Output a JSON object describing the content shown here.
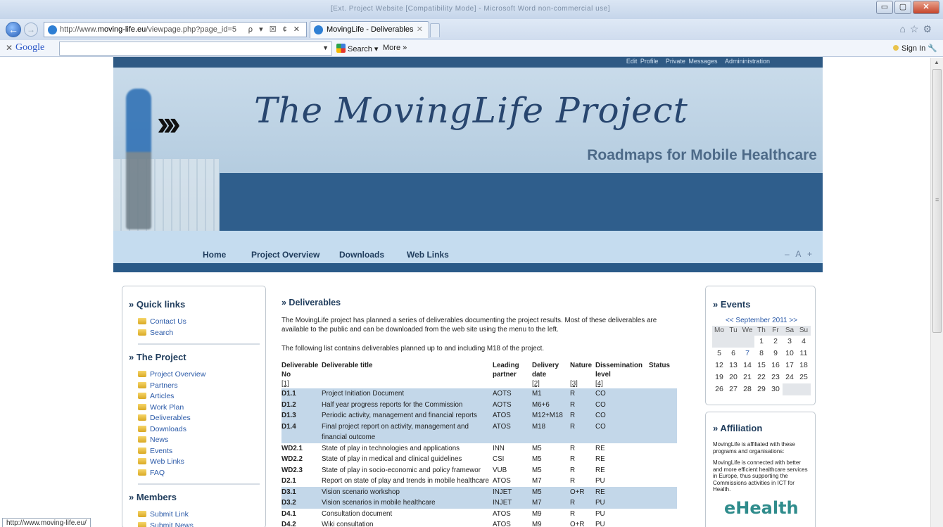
{
  "browser": {
    "title_blur": "[Ext. Project Website [Compatibility Mode] - Microsoft Word non-commercial use]",
    "address": {
      "prefix": "http://www.",
      "domain": "moving-life.eu",
      "path": "/viewpage.php?page_id=5"
    },
    "address_tools": "ρ ▾ ☒ ¢ ✕",
    "tab_label": "MovingLife - Deliverables",
    "tab_close": "✕",
    "google_toolbar": {
      "close": "✕",
      "logo": "Google",
      "search_button": "Search ▾",
      "more": "More »",
      "sign_in": "Sign In"
    },
    "status_url": "http://www.moving-life.eu/"
  },
  "site": {
    "toplinks": [
      "Edit Profile",
      "Private Messages",
      "Admininistration"
    ],
    "banner_title": "The MovingLife Project",
    "tagline": "Roadmaps for Mobile Healthcare",
    "menu": [
      "Home",
      "Project Overview",
      "Downloads",
      "Web Links"
    ],
    "font_controls": "– A +"
  },
  "left": {
    "quick_links_title": "» Quick links",
    "quick_links": [
      "Contact Us",
      "Search"
    ],
    "project_title": "» The Project",
    "project_links": [
      "Project Overview",
      "Partners",
      "Articles",
      "Work Plan",
      "Deliverables",
      "Downloads",
      "News",
      "Events",
      "Web Links",
      "FAQ"
    ],
    "members_title": "» Members",
    "members_links": [
      "Submit Link",
      "Submit News"
    ]
  },
  "content": {
    "heading": "» Deliverables",
    "para1": "The MovingLife project has planned a series of deliverables documenting the project results. Most of these deliverables are available to the public and can be downloaded from the web site using the menu to the left.",
    "para2": "The following list contains deliverables planned up to and including M18 of the project.",
    "table": {
      "headers": [
        "Deliverable No",
        "Deliverable title",
        "Leading partner",
        "Delivery date",
        "Nature",
        "Dissemination level",
        "Status"
      ],
      "refs": [
        "[1]",
        "",
        "",
        "[2]",
        "[3]",
        "[4]",
        ""
      ],
      "rows": [
        [
          "D1.1",
          "Project Initiation Document",
          "AOTS",
          "M1",
          "R",
          "CO",
          ""
        ],
        [
          "D1.2",
          "Half year progress reports for the Commission",
          "AOTS",
          "M6+6",
          "R",
          "CO",
          ""
        ],
        [
          "D1.3",
          "Periodic activity, management and financial reports",
          "ATOS",
          "M12+M18",
          "R",
          "CO",
          ""
        ],
        [
          "D1.4",
          "Final project report on activity, management and",
          "ATOS",
          "M18",
          "R",
          "CO",
          ""
        ],
        [
          "",
          "financial outcome",
          "",
          "",
          "",
          "",
          ""
        ],
        [
          "WD2.1",
          "State of play in technologies and applications",
          "INN",
          "M5",
          "R",
          "RE",
          ""
        ],
        [
          "WD2.2",
          "State of play in medical and clinical guidelines",
          "CSI",
          "M5",
          "R",
          "RE",
          ""
        ],
        [
          "WD2.3",
          "State of play in socio-economic and policy framewor",
          "VUB",
          "M5",
          "R",
          "RE",
          ""
        ],
        [
          "D2.1",
          "Report on state of play and trends in mobile healthcare",
          "ATOS",
          "M7",
          "R",
          "PU",
          ""
        ],
        [
          "D3.1",
          "Vision scenario workshop",
          "INJET",
          "M5",
          "O+R",
          "RE",
          ""
        ],
        [
          "D3.2",
          "Vision scenarios in mobile healthcare",
          "INJET",
          "M7",
          "R",
          "PU",
          ""
        ],
        [
          "D4.1",
          "Consultation document",
          "ATOS",
          "M9",
          "R",
          "PU",
          ""
        ],
        [
          "D4.2",
          "Wiki consultation",
          "ATOS",
          "M9",
          "O+R",
          "PU",
          ""
        ]
      ],
      "highlight_rows": [
        0,
        1,
        2,
        3,
        4,
        9,
        10
      ]
    }
  },
  "right": {
    "events_title": "» Events",
    "calendar_header": "<< September 2011 >>",
    "dow": [
      "Mo",
      "Tu",
      "We",
      "Th",
      "Fr",
      "Sa",
      "Su"
    ],
    "days": [
      "",
      "",
      "",
      "1",
      "2",
      "3",
      "4",
      "5",
      "6",
      "7",
      "8",
      "9",
      "10",
      "11",
      "12",
      "13",
      "14",
      "15",
      "16",
      "17",
      "18",
      "19",
      "20",
      "21",
      "22",
      "23",
      "24",
      "25",
      "26",
      "27",
      "28",
      "29",
      "30",
      "",
      ""
    ],
    "today": "7",
    "affiliation_title": "» Affiliation",
    "aff_text1": "MovingLife is affiliated with these programs and organisations:",
    "aff_text2": "MovingLife is connected with better and more efficient healthcare services in Europe, thus supporting the Commissions activities in ICT for Health.",
    "ehealth_logo": "eHealth"
  },
  "colors": {
    "site_blue": "#2f5a84",
    "menu_bg": "#c5dcef",
    "highlight_row": "#c3d7e9",
    "link": "#2b5aa8"
  }
}
